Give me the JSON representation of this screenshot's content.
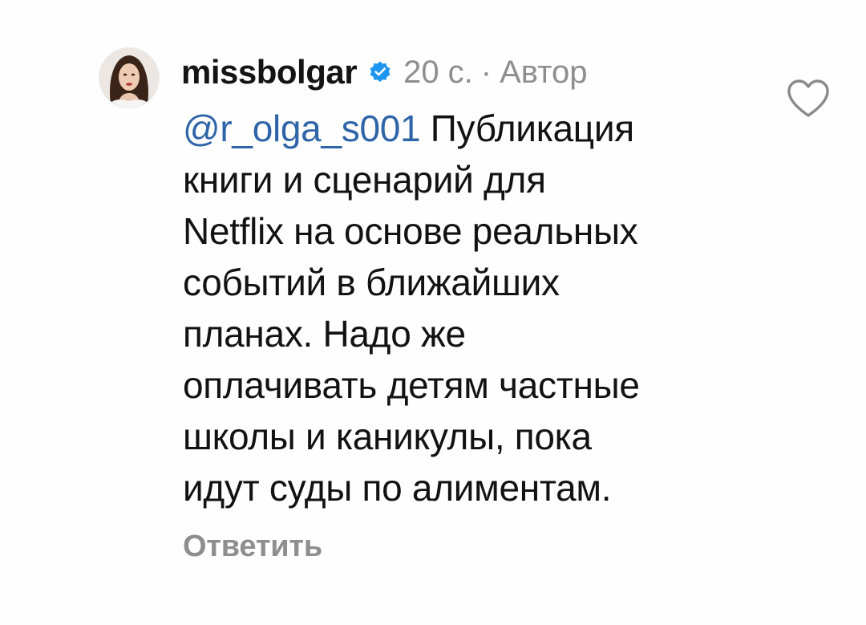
{
  "comment": {
    "username": "missbolgar",
    "verified": true,
    "time": "20 с.",
    "separator": "·",
    "role": "Автор",
    "mention": "@r_olga_s001",
    "text_lines": [
      "Публикация",
      "книги и сценарий для",
      "Netflix на основе реальных",
      "событий в ближайших",
      "планах. Надо же",
      "оплачивать детям частные",
      "школы и каникулы, пока",
      "идут суды по алиментам."
    ],
    "reply_label": "Ответить"
  },
  "icons": {
    "avatar": "profile-photo",
    "verified": "verified-badge-icon",
    "like": "heart-outline-icon"
  },
  "colors": {
    "mention": "#2f65a8",
    "verified": "#1c96f0",
    "muted": "#8e8e8e",
    "text": "#121212"
  }
}
